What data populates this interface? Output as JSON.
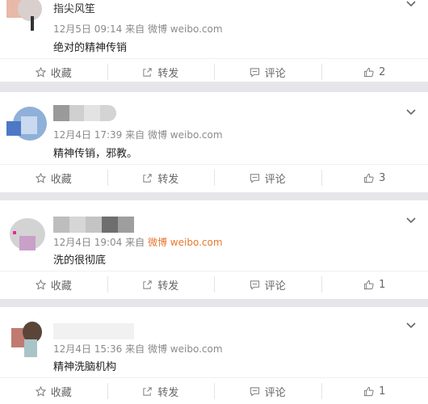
{
  "posts": [
    {
      "name": "指尖风笙",
      "time": "12月5日 09:14",
      "via": "来自",
      "source": "微博 weibo.com",
      "source_highlight": false,
      "text": "绝对的精神传销",
      "actions": {
        "fav": "收藏",
        "repost": "转发",
        "comment": "评论",
        "like_count": "2"
      }
    },
    {
      "name": "",
      "time": "12月4日 17:39",
      "via": "来自",
      "source": "微博 weibo.com",
      "source_highlight": false,
      "text": "精神传销，邪教。",
      "actions": {
        "fav": "收藏",
        "repost": "转发",
        "comment": "评论",
        "like_count": "3"
      }
    },
    {
      "name": "",
      "time": "12月4日 19:04",
      "via": "来自",
      "source": "微博 weibo.com",
      "source_highlight": true,
      "text": "洗的很彻底",
      "actions": {
        "fav": "收藏",
        "repost": "转发",
        "comment": "评论",
        "like_count": "1"
      }
    },
    {
      "name": "",
      "time": "12月4日 15:36",
      "via": "来自",
      "source": "微博 weibo.com",
      "source_highlight": false,
      "text": "精神洗脑机构",
      "actions": {
        "fav": "收藏",
        "repost": "转发",
        "comment": "评论",
        "like_count": "1"
      }
    }
  ],
  "colors": {
    "source_highlight": "#e8762d",
    "divider": "#e6e6ea"
  },
  "icons": {
    "fav": "star-icon",
    "repost": "share-icon",
    "comment": "comment-icon",
    "like": "thumbs-up-icon",
    "more": "chevron-down-icon"
  }
}
